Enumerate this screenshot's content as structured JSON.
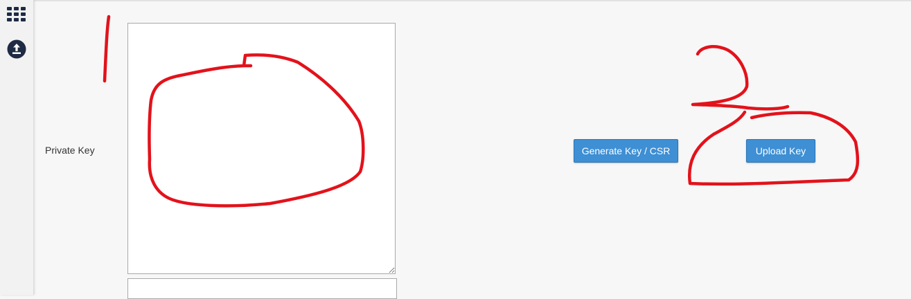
{
  "sidebar": {
    "items": [
      {
        "icon": "grid-icon"
      },
      {
        "icon": "upload-icon"
      }
    ]
  },
  "form": {
    "private_key_label": "Private Key",
    "private_key_value": ""
  },
  "actions": {
    "generate_label": "Generate Key / CSR",
    "upload_label": "Upload Key"
  },
  "colors": {
    "button_bg": "#3e8fd4",
    "annotation": "#e3121b",
    "icon_dark": "#1f2a44"
  }
}
